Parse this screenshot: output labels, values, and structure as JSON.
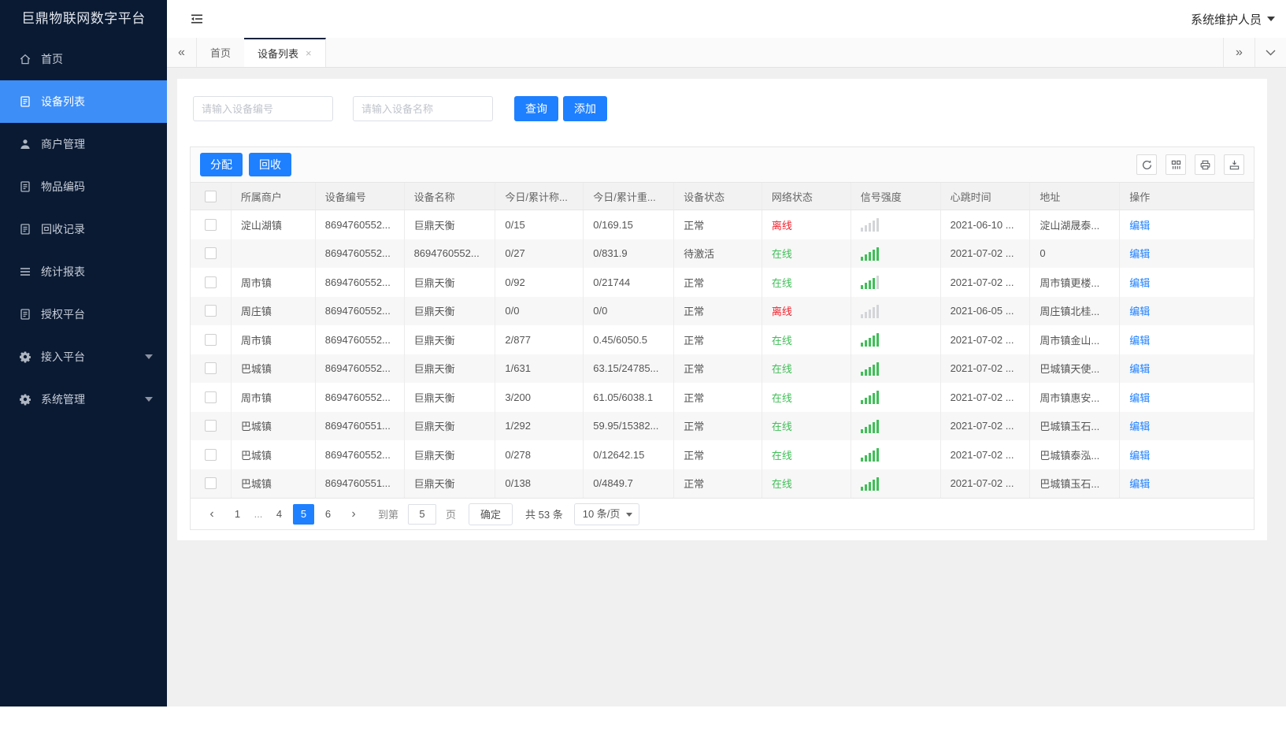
{
  "app": {
    "title": "巨鼎物联网数字平台",
    "user": "系统维护人员"
  },
  "colors": {
    "primary": "#1e80ff",
    "sidebar_bg": "#0a1a33",
    "sidebar_active": "#3e8ef7",
    "online_green": "#3fbf57",
    "offline_red": "#f5222d"
  },
  "sidebar": {
    "items": [
      {
        "label": "首页",
        "icon": "home-icon",
        "active": false
      },
      {
        "label": "设备列表",
        "icon": "document-icon",
        "active": true
      },
      {
        "label": "商户管理",
        "icon": "user-icon",
        "active": false
      },
      {
        "label": "物品编码",
        "icon": "document-icon",
        "active": false
      },
      {
        "label": "回收记录",
        "icon": "document-icon",
        "active": false
      },
      {
        "label": "统计报表",
        "icon": "menu-lines-icon",
        "active": false
      },
      {
        "label": "授权平台",
        "icon": "document-icon",
        "active": false
      },
      {
        "label": "接入平台",
        "icon": "gear-icon",
        "active": false,
        "caret": true
      },
      {
        "label": "系统管理",
        "icon": "gear-icon",
        "active": false,
        "caret": true
      }
    ]
  },
  "tabs": {
    "items": [
      {
        "label": "首页",
        "active": false,
        "closable": false
      },
      {
        "label": "设备列表",
        "active": true,
        "closable": true,
        "close_glyph": "×"
      }
    ]
  },
  "search": {
    "device_no_placeholder": "请输入设备编号",
    "device_name_placeholder": "请输入设备名称",
    "query_label": "查询",
    "add_label": "添加"
  },
  "toolbar": {
    "assign_label": "分配",
    "recycle_label": "回收",
    "icons": [
      "refresh-icon",
      "columns-icon",
      "print-icon",
      "export-icon"
    ]
  },
  "table": {
    "headers": [
      "所属商户",
      "设备编号",
      "设备名称",
      "今日/累计称...",
      "今日/累计重...",
      "设备状态",
      "网络状态",
      "信号强度",
      "心跳时间",
      "地址",
      "操作"
    ],
    "rows": [
      {
        "merchant": "淀山湖镇",
        "device_no": "8694760552...",
        "device_name": "巨鼎天衡",
        "today_count": "0/15",
        "today_weight": "0/169.15",
        "device_status": "正常",
        "network_status": "离线",
        "online": false,
        "signal": 0,
        "heartbeat": "2021-06-10 ...",
        "address": "淀山湖晟泰...",
        "action": "编辑"
      },
      {
        "merchant": "",
        "device_no": "8694760552...",
        "device_name": "8694760552...",
        "today_count": "0/27",
        "today_weight": "0/831.9",
        "device_status": "待激活",
        "network_status": "在线",
        "online": true,
        "signal": 5,
        "heartbeat": "2021-07-02 ...",
        "address": "0",
        "action": "编辑"
      },
      {
        "merchant": "周市镇",
        "device_no": "8694760552...",
        "device_name": "巨鼎天衡",
        "today_count": "0/92",
        "today_weight": "0/21744",
        "device_status": "正常",
        "network_status": "在线",
        "online": true,
        "signal": 4,
        "heartbeat": "2021-07-02 ...",
        "address": "周市镇更楼...",
        "action": "编辑"
      },
      {
        "merchant": "周庄镇",
        "device_no": "8694760552...",
        "device_name": "巨鼎天衡",
        "today_count": "0/0",
        "today_weight": "0/0",
        "device_status": "正常",
        "network_status": "离线",
        "online": false,
        "signal": 0,
        "heartbeat": "2021-06-05 ...",
        "address": "周庄镇北桂...",
        "action": "编辑"
      },
      {
        "merchant": "周市镇",
        "device_no": "8694760552...",
        "device_name": "巨鼎天衡",
        "today_count": "2/877",
        "today_weight": "0.45/6050.5",
        "device_status": "正常",
        "network_status": "在线",
        "online": true,
        "signal": 5,
        "heartbeat": "2021-07-02 ...",
        "address": "周市镇金山...",
        "action": "编辑"
      },
      {
        "merchant": "巴城镇",
        "device_no": "8694760552...",
        "device_name": "巨鼎天衡",
        "today_count": "1/631",
        "today_weight": "63.15/24785...",
        "device_status": "正常",
        "network_status": "在线",
        "online": true,
        "signal": 5,
        "heartbeat": "2021-07-02 ...",
        "address": "巴城镇天使...",
        "action": "编辑"
      },
      {
        "merchant": "周市镇",
        "device_no": "8694760552...",
        "device_name": "巨鼎天衡",
        "today_count": "3/200",
        "today_weight": "61.05/6038.1",
        "device_status": "正常",
        "network_status": "在线",
        "online": true,
        "signal": 5,
        "heartbeat": "2021-07-02 ...",
        "address": "周市镇惠安...",
        "action": "编辑"
      },
      {
        "merchant": "巴城镇",
        "device_no": "8694760551...",
        "device_name": "巨鼎天衡",
        "today_count": "1/292",
        "today_weight": "59.95/15382...",
        "device_status": "正常",
        "network_status": "在线",
        "online": true,
        "signal": 5,
        "heartbeat": "2021-07-02 ...",
        "address": "巴城镇玉石...",
        "action": "编辑"
      },
      {
        "merchant": "巴城镇",
        "device_no": "8694760552...",
        "device_name": "巨鼎天衡",
        "today_count": "0/278",
        "today_weight": "0/12642.15",
        "device_status": "正常",
        "network_status": "在线",
        "online": true,
        "signal": 5,
        "heartbeat": "2021-07-02 ...",
        "address": "巴城镇泰泓...",
        "action": "编辑"
      },
      {
        "merchant": "巴城镇",
        "device_no": "8694760551...",
        "device_name": "巨鼎天衡",
        "today_count": "0/138",
        "today_weight": "0/4849.7",
        "device_status": "正常",
        "network_status": "在线",
        "online": true,
        "signal": 5,
        "heartbeat": "2021-07-02 ...",
        "address": "巴城镇玉石...",
        "action": "编辑"
      }
    ]
  },
  "pagination": {
    "pages": [
      "1",
      "...",
      "4",
      "5",
      "6"
    ],
    "active_page": "5",
    "goto_label": "到第",
    "goto_value": "5",
    "page_unit_label": "页",
    "confirm_label": "确定",
    "total_label": "共 53 条",
    "page_size_label": "10 条/页"
  }
}
